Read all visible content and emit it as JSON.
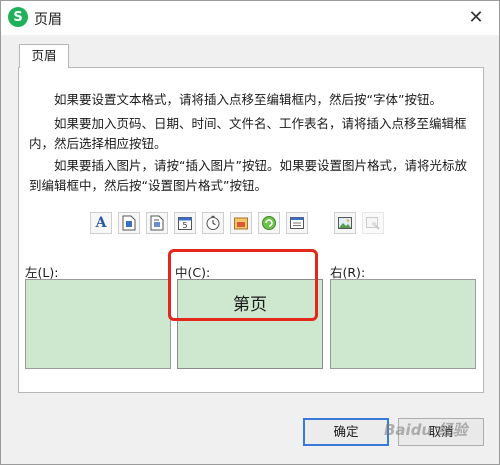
{
  "window": {
    "title": "页眉",
    "app_icon_letter": "S",
    "close_glyph": "✕"
  },
  "tabs": [
    {
      "label": "页眉"
    }
  ],
  "instructions": [
    "如果要设置文本格式，请将插入点移至编辑框内，然后按“字体”按钮。",
    "如果要加入页码、日期、时间、文件名、工作表名，请将插入点移至编辑框内，然后选择相应按钮。",
    "如果要插入图片，请按“插入图片”按钮。如果要设置图片格式，请将光标放到编辑框中，然后按“设置图片格式”按钮。"
  ],
  "toolbar": {
    "buttons": [
      {
        "name": "font-button",
        "icon": "font-icon",
        "glyph": "A"
      },
      {
        "name": "page-number-button",
        "icon": "page-number-icon"
      },
      {
        "name": "total-pages-button",
        "icon": "total-pages-icon"
      },
      {
        "name": "date-button",
        "icon": "date-icon"
      },
      {
        "name": "time-button",
        "icon": "clock-icon"
      },
      {
        "name": "file-path-button",
        "icon": "file-path-icon"
      },
      {
        "name": "file-name-button",
        "icon": "file-name-icon"
      },
      {
        "name": "sheet-name-button",
        "icon": "sheet-name-icon"
      },
      {
        "name": "insert-picture-button",
        "icon": "picture-icon"
      },
      {
        "name": "format-picture-button",
        "icon": "format-picture-icon",
        "disabled": true
      }
    ]
  },
  "sections": {
    "left": {
      "label": "左(L):",
      "value": ""
    },
    "center": {
      "label": "中(C):",
      "value": "第页"
    },
    "right": {
      "label": "右(R):",
      "value": ""
    }
  },
  "buttons": {
    "ok": "确定",
    "cancel": "取消"
  },
  "watermark": "Baidu 经验",
  "colors": {
    "edit_box_bg": "#cde8cf",
    "highlight_border": "#e4271c",
    "app_icon": "#1fb25a",
    "primary_border": "#3a7bd5"
  }
}
